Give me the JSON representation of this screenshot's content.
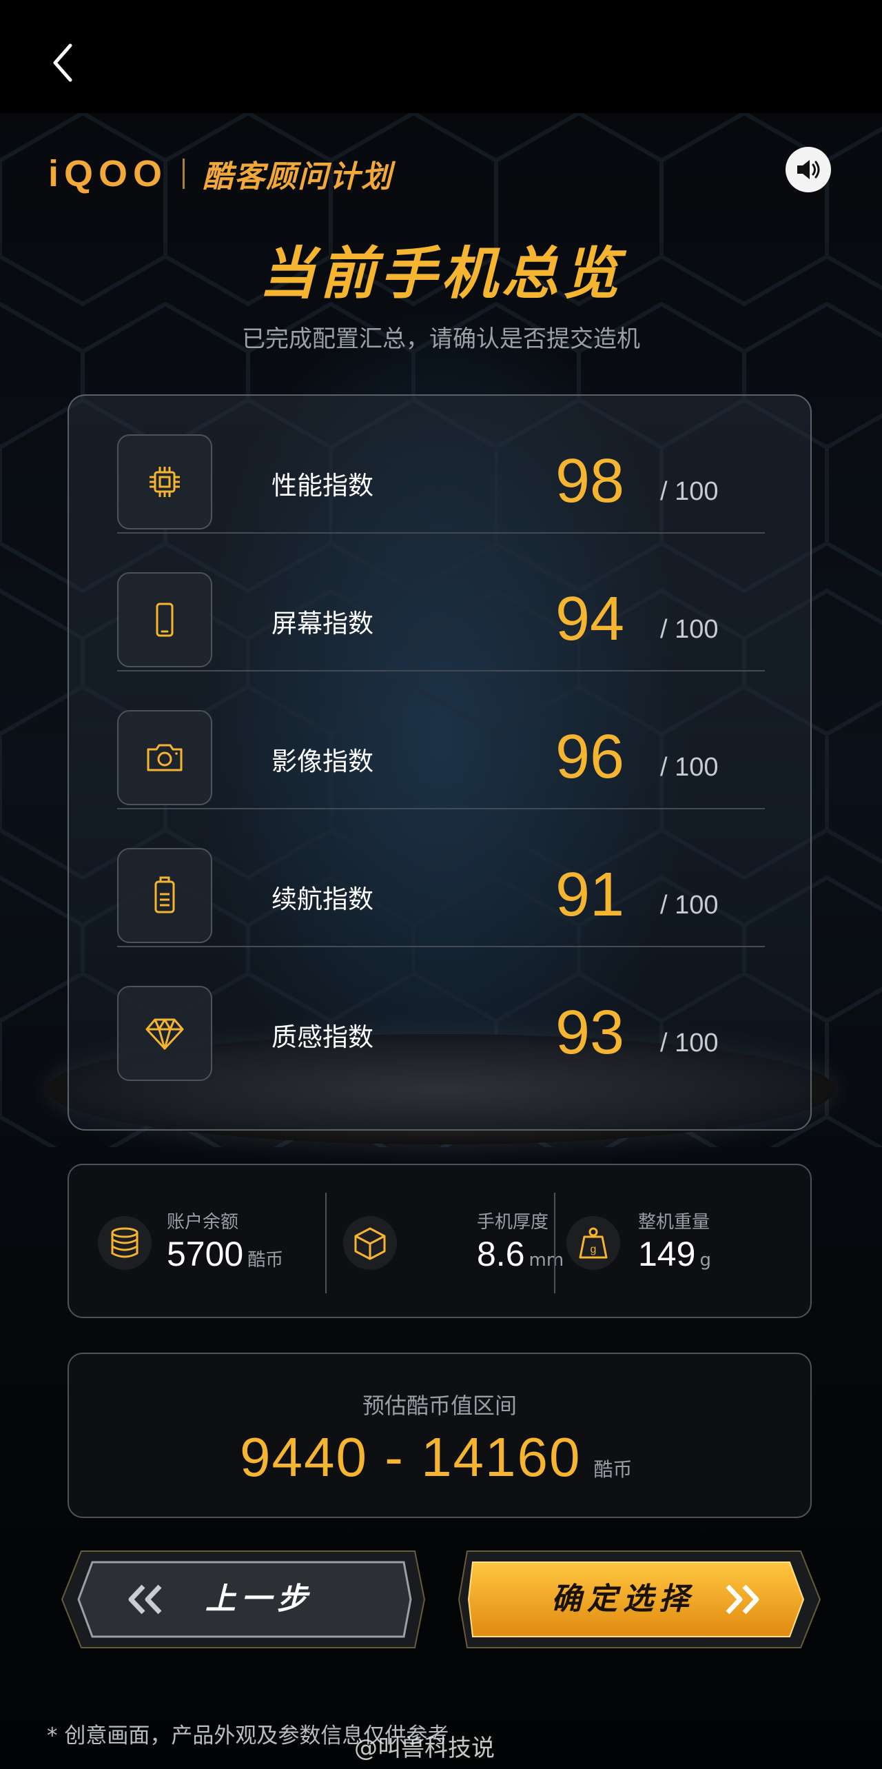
{
  "header": {
    "brand_logo": "iQOO",
    "program_name": "酷客顾问计划",
    "back_icon": "chevron-left-icon",
    "sound_icon": "speaker-icon"
  },
  "title": "当前手机总览",
  "subtitle": "已完成配置汇总，请确认是否提交造机",
  "scores": [
    {
      "icon": "chip-icon",
      "label": "性能指数",
      "score": "98",
      "max": "/ 100"
    },
    {
      "icon": "phone-icon",
      "label": "屏幕指数",
      "score": "94",
      "max": "/ 100"
    },
    {
      "icon": "camera-icon",
      "label": "影像指数",
      "score": "96",
      "max": "/ 100"
    },
    {
      "icon": "battery-icon",
      "label": "续航指数",
      "score": "91",
      "max": "/ 100"
    },
    {
      "icon": "diamond-icon",
      "label": "质感指数",
      "score": "93",
      "max": "/ 100"
    }
  ],
  "stats": [
    {
      "icon": "coins-icon",
      "label": "账户余额",
      "value": "5700",
      "unit": "酷币"
    },
    {
      "icon": "cube-icon",
      "label": "手机厚度",
      "value": "8.6",
      "unit": "mm"
    },
    {
      "icon": "weight-icon",
      "label": "整机重量",
      "value": "149",
      "unit": "g"
    }
  ],
  "estimate": {
    "label": "预估酷币值区间",
    "range": "9440 - 14160",
    "unit": "酷币"
  },
  "buttons": {
    "prev_label": "上一步",
    "confirm_label": "确定选择"
  },
  "footnote": "* 创意画面，产品外观及参数信息仅供参考",
  "watermark": "@叫兽科技说",
  "colors": {
    "accent": "#f5b531",
    "background": "#000000",
    "card_border": "#4d535b"
  }
}
